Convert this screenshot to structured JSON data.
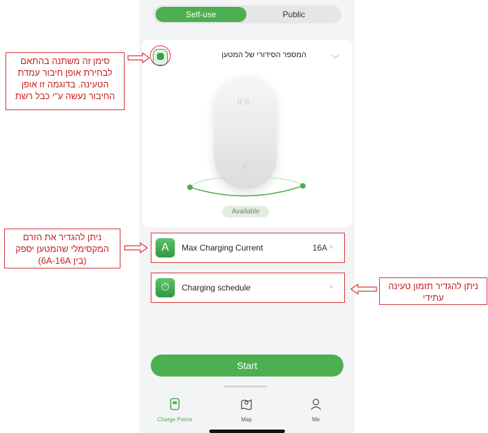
{
  "tabs_top": {
    "self_use": "Self-use",
    "public": "Public"
  },
  "charger": {
    "serial_label": "המספר הסידורי של המטען",
    "status": "Available"
  },
  "settings": [
    {
      "label": "Max Charging Current",
      "value": "16A",
      "icon_text": "A"
    },
    {
      "label": "Charging schedule",
      "value": "",
      "icon_text": "⏱"
    }
  ],
  "start_label": "Start",
  "bottom_nav": [
    {
      "label": "Charge Points",
      "icon": "charger-icon"
    },
    {
      "label": "Map",
      "icon": "map-icon"
    },
    {
      "label": "Me",
      "icon": "user-icon"
    }
  ],
  "annotations": {
    "connection": [
      "סימן זה משתנה בהתאם",
      "לבחירת אופן חיבור עמדת",
      "הטעינה. בדוגמה זו אופן",
      "החיבור נעשה ע\"י כבל רשת"
    ],
    "max_current": [
      "ניתן להגדיר את הזרם",
      "המקסימלי שהמטען יספק",
      "(בין 6A-16A)"
    ],
    "schedule": [
      "ניתן להגדיר תזמון טעינה",
      "עתידי"
    ]
  },
  "colors": {
    "accent": "#4caf50",
    "annotation": "#d63333"
  }
}
